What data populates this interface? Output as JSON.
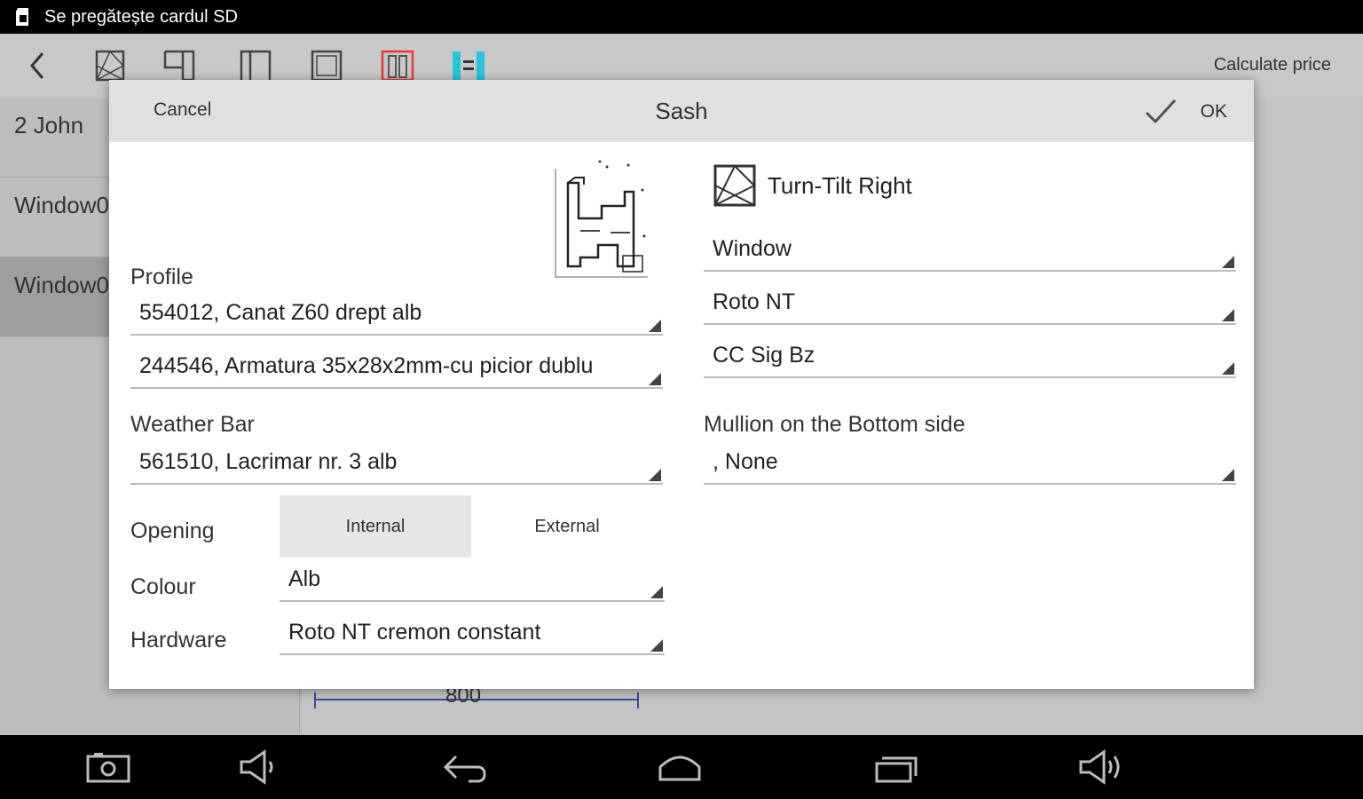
{
  "status_bar": {
    "text": "Se pregătește cardul SD",
    "icon": "sd-card-icon"
  },
  "toolbar": {
    "back_icon": "back-arrow-icon",
    "tools": [
      "turn-tilt-icon",
      "sash-left-icon",
      "sash-frame-icon",
      "fixed-frame-icon",
      "double-sash-icon",
      "mullion-icon"
    ],
    "calculate_price": "Calculate price",
    "active_color": "#e53935",
    "accent_color": "#26c6da"
  },
  "left_list": {
    "items": [
      {
        "label": "2 John"
      },
      {
        "label": "Window0"
      },
      {
        "label": "Window0"
      }
    ]
  },
  "drawing": {
    "dimension": "800"
  },
  "dialog": {
    "title": "Sash",
    "cancel": "Cancel",
    "ok": "OK",
    "profile": {
      "label": "Profile",
      "value": "554012, Canat Z60 drept alb",
      "reinforcement": "244546, Armatura 35x28x2mm-cu picior dublu"
    },
    "weather_bar": {
      "label": "Weather Bar",
      "value": "561510, Lacrimar nr. 3 alb"
    },
    "opening": {
      "label": "Opening",
      "options": [
        "Internal",
        "External"
      ],
      "selected": "Internal"
    },
    "colour": {
      "label": "Colour",
      "value": "Alb"
    },
    "hardware": {
      "label": "Hardware",
      "value": "Roto NT cremon constant"
    },
    "sash_type": {
      "label": "Turn-Tilt Right",
      "icon": "turn-tilt-icon"
    },
    "right_spinners": [
      "Window",
      "Roto NT",
      "CC Sig Bz"
    ],
    "mullion_bottom": {
      "label": "Mullion on the Bottom side",
      "value": ", None"
    }
  },
  "nav_bar": {
    "icons": [
      "screenshot-icon",
      "volume-down-icon",
      "back-icon",
      "home-icon",
      "recent-apps-icon",
      "volume-up-icon"
    ]
  }
}
